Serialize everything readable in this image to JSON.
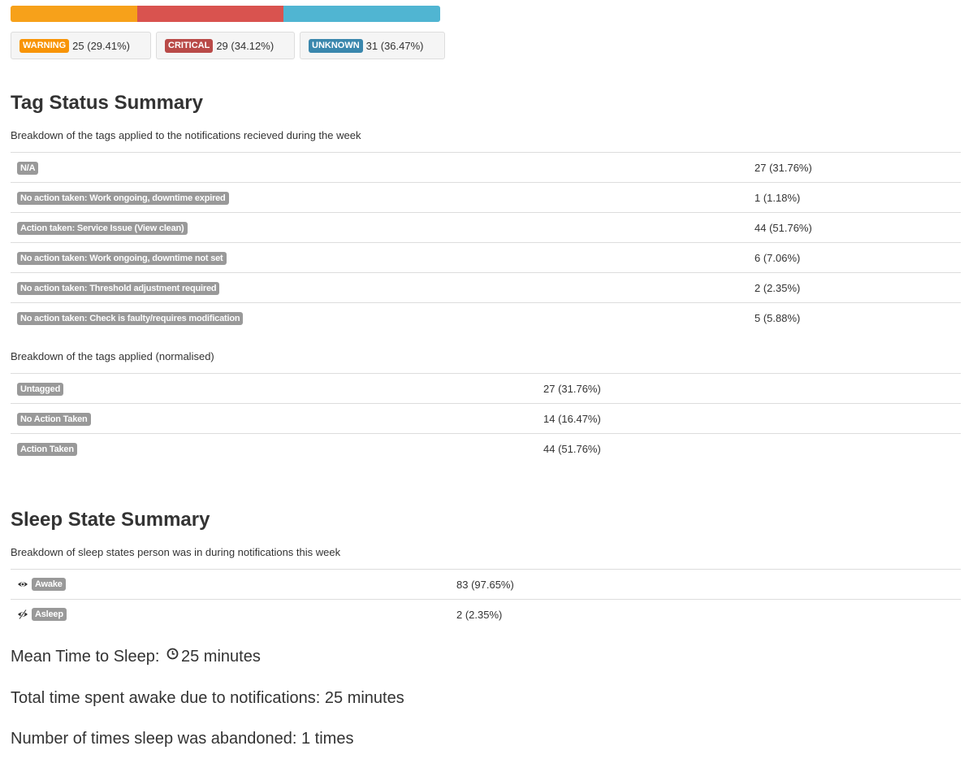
{
  "progress": {
    "segments": [
      {
        "name": "warning",
        "fraction": 0.2941,
        "color": "#f89406"
      },
      {
        "name": "critical",
        "fraction": 0.3412,
        "color": "#b94a48"
      },
      {
        "name": "unknown",
        "fraction": 0.3647,
        "color": "#3a87ad"
      }
    ],
    "bar_colors": [
      "#f7a11a",
      "#d9534f",
      "#50b5d2"
    ]
  },
  "status": [
    {
      "label": "WARNING",
      "value": "25 (29.41%)",
      "color": "#f89406"
    },
    {
      "label": "CRITICAL",
      "value": "29 (34.12%)",
      "color": "#b94a48"
    },
    {
      "label": "UNKNOWN",
      "value": "31 (36.47%)",
      "color": "#3a87ad"
    }
  ],
  "tag_summary": {
    "title": "Tag Status Summary",
    "description": "Breakdown of the tags applied to the notifications recieved during the week",
    "rows": [
      {
        "tag": "N/A",
        "value": "27 (31.76%)"
      },
      {
        "tag": "No action taken: Work ongoing, downtime expired",
        "value": "1 (1.18%)"
      },
      {
        "tag": "Action taken: Service Issue (View clean)",
        "value": "44 (51.76%)"
      },
      {
        "tag": "No action taken: Work ongoing, downtime not set",
        "value": "6 (7.06%)"
      },
      {
        "tag": "No action taken: Threshold adjustment required",
        "value": "2 (2.35%)"
      },
      {
        "tag": "No action taken: Check is faulty/requires modification",
        "value": "5 (5.88%)"
      }
    ],
    "normalised_description": "Breakdown of the tags applied (normalised)",
    "normalised_rows": [
      {
        "tag": "Untagged",
        "value": "27 (31.76%)"
      },
      {
        "tag": "No Action Taken",
        "value": "14 (16.47%)"
      },
      {
        "tag": "Action Taken",
        "value": "44 (51.76%)"
      }
    ]
  },
  "sleep_summary": {
    "title": "Sleep State Summary",
    "description": "Breakdown of sleep states person was in during notifications this week",
    "rows": [
      {
        "icon": "eye-open-icon",
        "tag": "Awake",
        "value": "83 (97.65%)"
      },
      {
        "icon": "eye-closed-icon",
        "tag": "Asleep",
        "value": "2 (2.35%)"
      }
    ],
    "mean_label": "Mean Time to Sleep:",
    "mean_value": "25 minutes",
    "awake_text": "Total time spent awake due to notifications: 25 minutes",
    "abandoned_text": "Number of times sleep was abandoned: 1 times"
  }
}
